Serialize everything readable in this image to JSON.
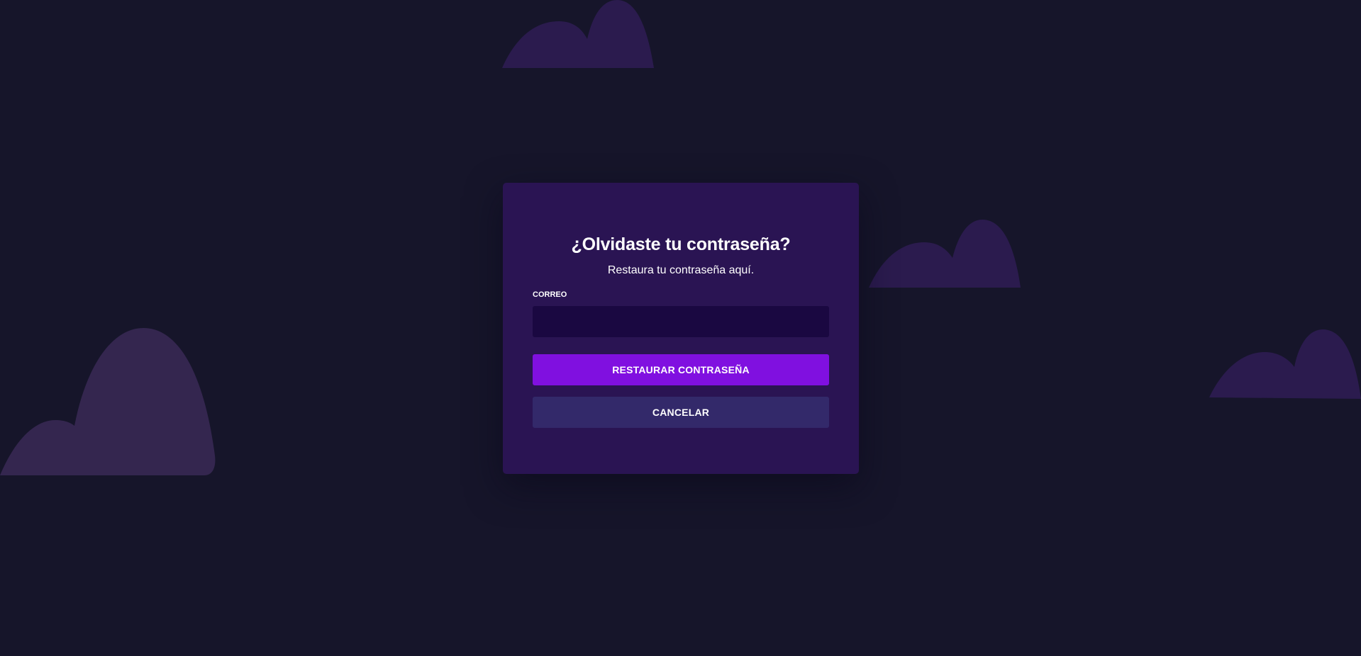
{
  "theme": {
    "background": "#16152a",
    "card": "#2a1453",
    "input": "#1a0841",
    "primary_button": "#8010e0",
    "secondary_button": "#33296a",
    "cloud_light": "#34264f",
    "cloud_dark": "#2b1b4e"
  },
  "decorations": [
    "cloud-shape",
    "cloud-shape",
    "cloud-shape",
    "cloud-shape"
  ],
  "form": {
    "title": "¿Olvidaste tu contraseña?",
    "subtitle": "Restaura tu contraseña aquí.",
    "email_label": "CORREO",
    "email_value": "",
    "submit_label": "RESTAURAR CONTRASEÑA",
    "cancel_label": "CANCELAR"
  }
}
